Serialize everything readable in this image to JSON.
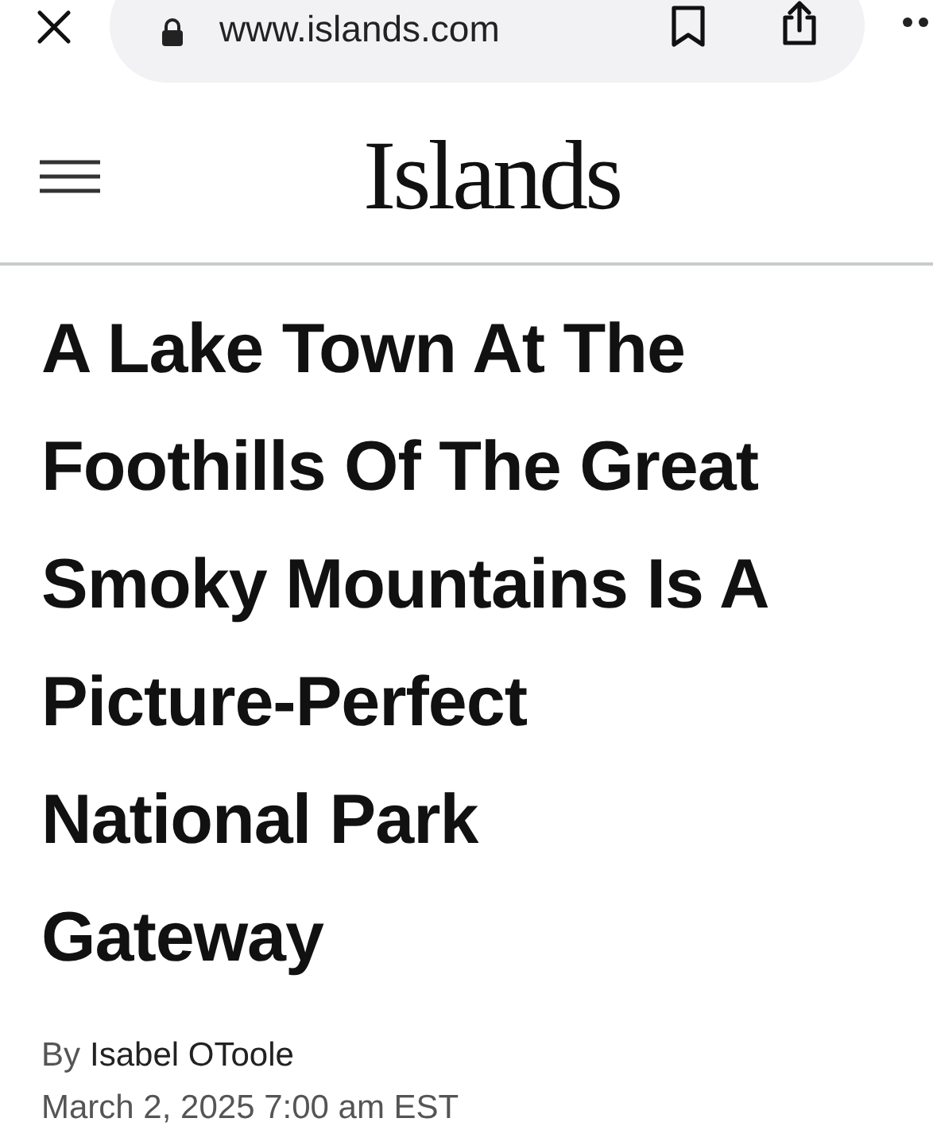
{
  "browser_bar": {
    "url": "www.islands.com"
  },
  "site_header": {
    "logo": "Islands"
  },
  "article": {
    "title_lines": [
      "A Lake Town At The",
      "Foothills Of The Great",
      "Smoky Mountains Is A",
      "Picture-Perfect",
      "National Park",
      "Gateway"
    ],
    "byline_prefix": "By",
    "author": "Isabel OToole",
    "date": "March 2, 2025 7:00 am EST"
  }
}
